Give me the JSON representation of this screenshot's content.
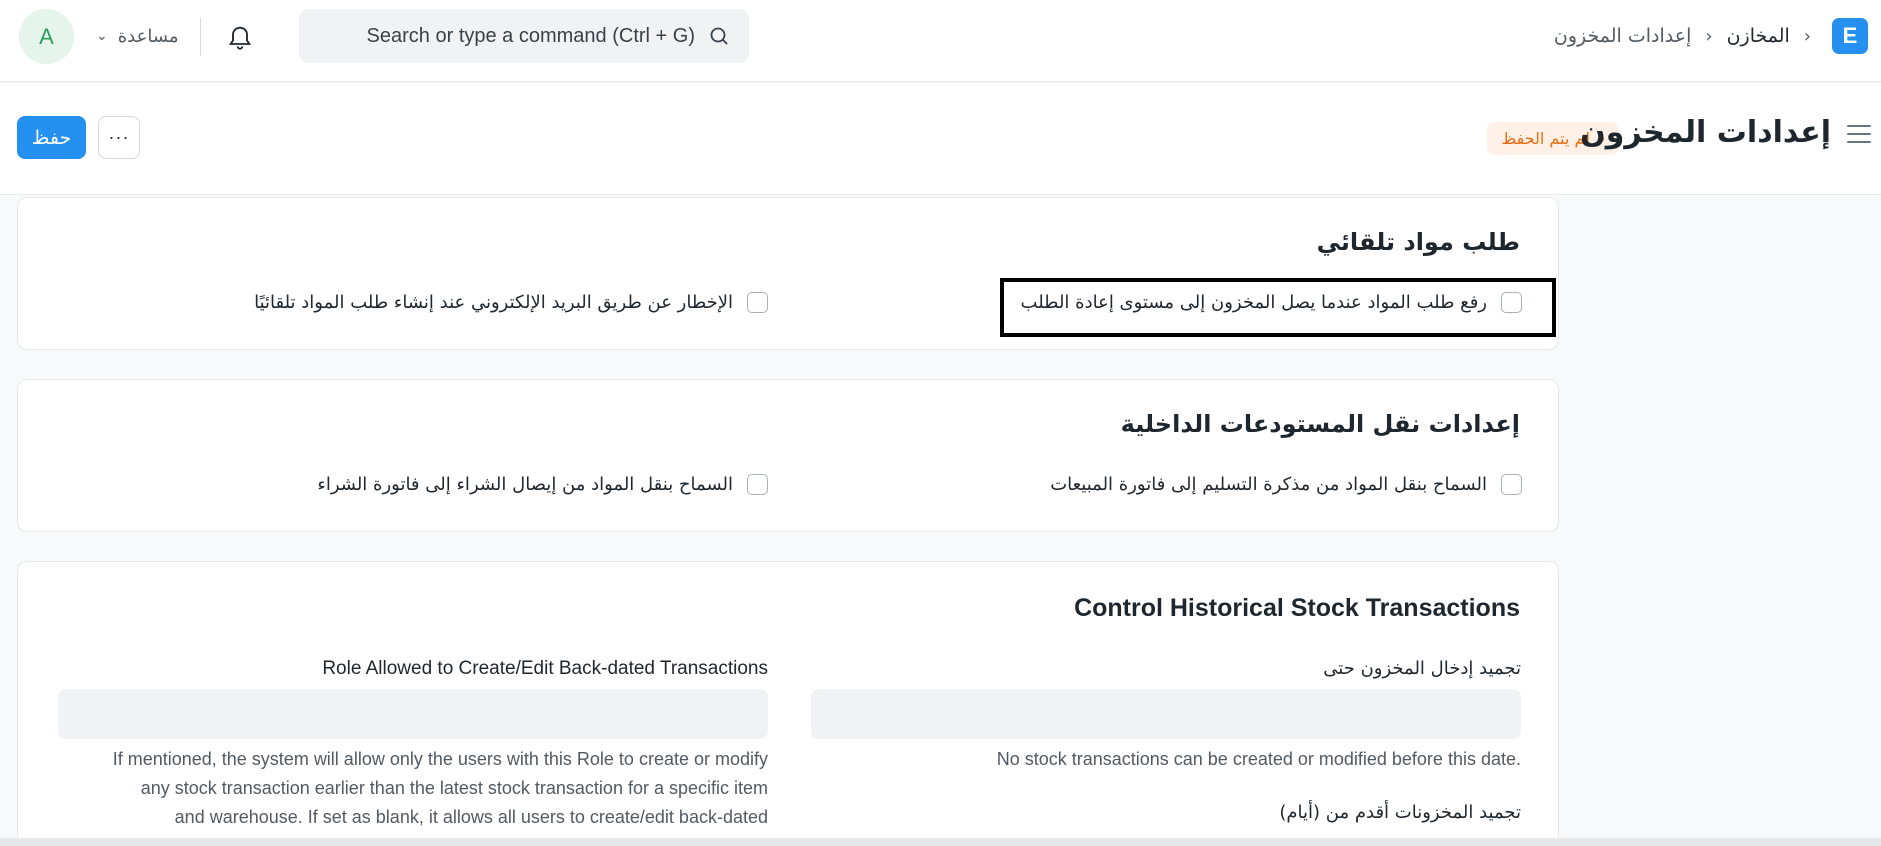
{
  "navbar": {
    "avatar_initial": "A",
    "help_label": "مساعدة",
    "search_placeholder": "Search or type a command (Ctrl + G)",
    "breadcrumbs": [
      "المخازن",
      "إعدادات المخزون"
    ],
    "logo_letter": "E"
  },
  "page_head": {
    "title": "إعدادات المخزون",
    "status": "لم يتم الحفظ",
    "save_label": "حفظ",
    "more_label": "···"
  },
  "sections": {
    "auto_material_request": {
      "title": "طلب مواد تلقائي",
      "checkbox_reorder": "رفع طلب المواد عندما يصل المخزون إلى مستوى إعادة الطلب",
      "checkbox_notify": "الإخطار عن طريق البريد الإلكتروني عند إنشاء طلب المواد تلقائيًا"
    },
    "inter_warehouse": {
      "title": "إعدادات نقل المستودعات الداخلية",
      "checkbox_delivery": "السماح بنقل المواد من مذكرة التسليم إلى فاتورة المبيعات",
      "checkbox_purchase": "السماح بنقل المواد من إيصال الشراء إلى فاتورة الشراء"
    },
    "historical": {
      "title": "Control Historical Stock Transactions",
      "freeze_label": "تجميد إدخال المخزون حتى",
      "freeze_desc": "No stock transactions can be created or modified before this date.",
      "freeze_days_label": "تجميد المخزونات أقدم من (أيام)",
      "role_label": "Role Allowed to Create/Edit Back-dated Transactions",
      "role_desc_1": "If mentioned, the system will allow only the users with this Role to create or modify",
      "role_desc_2": "any stock transaction earlier than the latest stock transaction for a specific item",
      "role_desc_3": "and warehouse. If set as blank, it allows all users to create/edit back-dated"
    }
  },
  "colors": {
    "primary": "#2490ef",
    "unsaved": "#e86c13",
    "avatar_bg": "#e6f5ec"
  }
}
